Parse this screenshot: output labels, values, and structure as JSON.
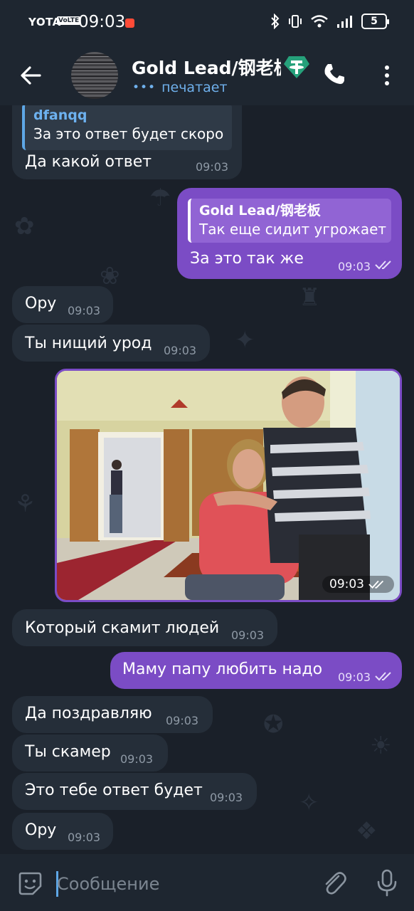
{
  "status_bar": {
    "carrier": "YOTA",
    "volte": "VoLTE",
    "time": "09:03",
    "battery": "5"
  },
  "header": {
    "title": "Gold Lead/钢老板",
    "status": "печатает",
    "icons": [
      "back-arrow-icon",
      "tether-icon",
      "phone-icon",
      "more-vert-icon"
    ]
  },
  "messages": [
    {
      "dir": "in",
      "reply_name": "dfanqq",
      "reply_text": "За это ответ будет скоро",
      "text": "Да какой ответ",
      "time": "09:03"
    },
    {
      "dir": "out",
      "reply_name": "Gold Lead/钢老板",
      "reply_text": "Так еще сидит угрожает",
      "text": "За это так же",
      "time": "09:03"
    },
    {
      "dir": "in",
      "text": "Ору",
      "time": "09:03"
    },
    {
      "dir": "in",
      "text": "Ты нищий урод",
      "time": "09:03"
    },
    {
      "dir": "out",
      "type": "photo",
      "time": "09:03"
    },
    {
      "dir": "in",
      "text": "Который скамит людей",
      "time": "09:03"
    },
    {
      "dir": "out",
      "text": "Маму папу любить надо",
      "time": "09:03"
    },
    {
      "dir": "in",
      "text": "Да поздравляю",
      "time": "09:03"
    },
    {
      "dir": "in",
      "text": "Ты скамер",
      "time": "09:03"
    },
    {
      "dir": "in",
      "text": "Это тебе ответ будет",
      "time": "09:03"
    },
    {
      "dir": "in",
      "text": "Ору",
      "time": "09:03"
    }
  ],
  "input": {
    "placeholder": "Сообщение"
  },
  "colors": {
    "background": "#1a2029",
    "bar": "#1e2630",
    "incoming": "#252e39",
    "outgoing": "#7b4cc5",
    "accent": "#5ea7e6"
  }
}
